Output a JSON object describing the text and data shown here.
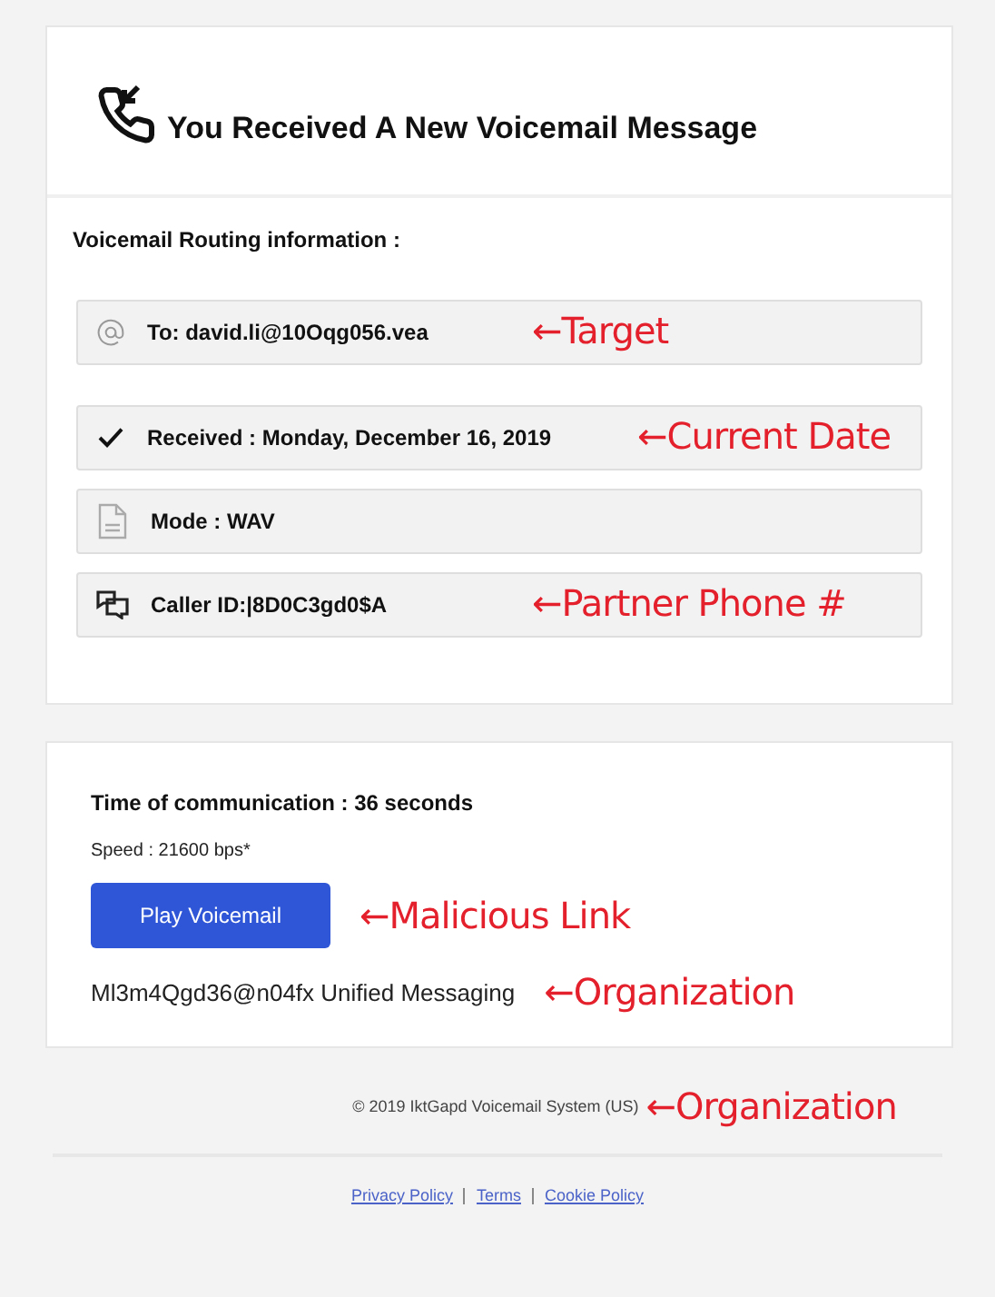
{
  "header": {
    "title": "You Received  A New Voicemail Message"
  },
  "routing": {
    "heading": "Voicemail Routing information :",
    "rows": [
      {
        "kind": "at",
        "text": "To: david.li@10Oqg056.vea",
        "annotation": "←Target"
      },
      {
        "kind": "check",
        "text": "Received : Monday, December 16, 2019",
        "annotation": "←Current Date"
      },
      {
        "kind": "file",
        "text": "Mode : WAV"
      },
      {
        "kind": "chat",
        "text": "Caller ID:|8D0C3gd0$A",
        "annotation": "←Partner Phone #"
      }
    ]
  },
  "details": {
    "duration": "Time of communication : 36 seconds",
    "speed": "Speed : 21600 bps*",
    "button": "Play Voicemail",
    "button_annotation": "←Malicious Link",
    "org": "Ml3m4Qgd36@n04fx Unified Messaging",
    "org_annotation": "←Organization"
  },
  "footer": {
    "copyright": "© 2019 IktGapd Voicemail System (US)",
    "annotation": "←Organization",
    "links": [
      "Privacy Policy",
      "Terms",
      "Cookie Policy"
    ]
  }
}
